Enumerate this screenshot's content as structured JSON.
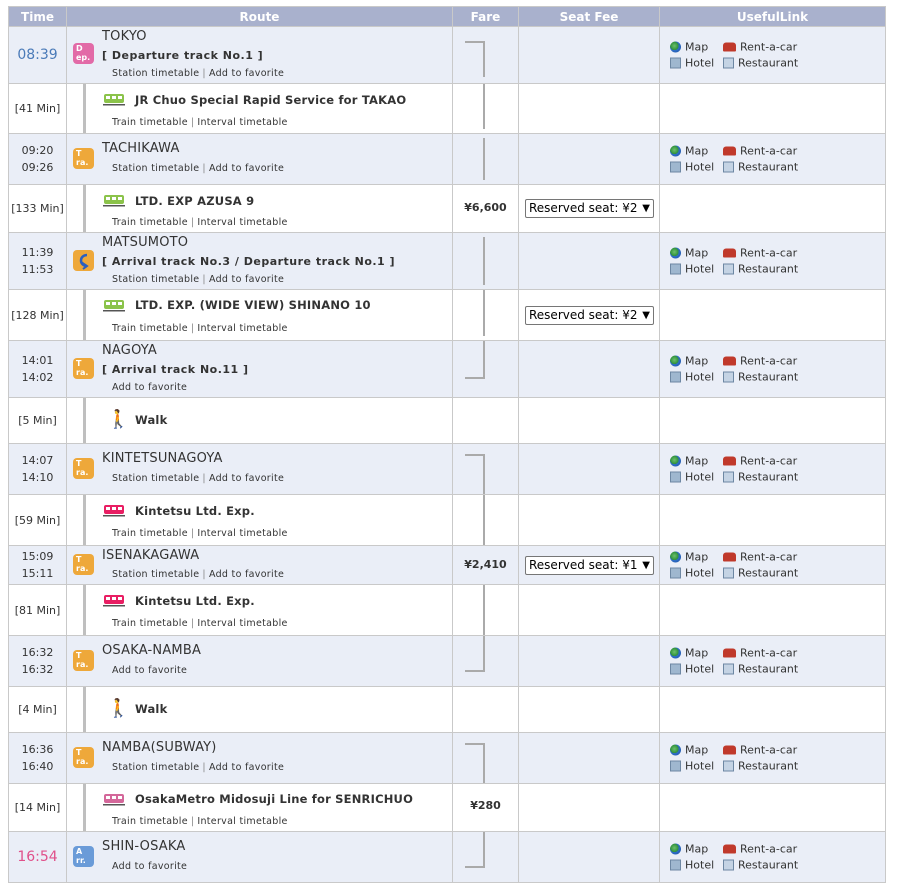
{
  "headers": {
    "time": "Time",
    "route": "Route",
    "fare": "Fare",
    "seat": "Seat Fee",
    "link": "UsefulLink"
  },
  "links": {
    "map": "Map",
    "rent": "Rent-a-car",
    "hotel": "Hotel",
    "restaurant": "Restaurant",
    "station_tt": "Station timetable",
    "fav": "Add to favorite",
    "train_tt": "Train timetable",
    "interval_tt": "Interval timetable",
    "sep": "|"
  },
  "badges": {
    "dep": "D\nep.",
    "tra": "T\nra.",
    "arr": "A\nrr."
  },
  "stations": {
    "tokyo": {
      "time": "08:39",
      "name": "TOKYO",
      "track": "[ Departure track No.1 ]"
    },
    "tachikawa": {
      "arr": "09:20",
      "dep": "09:26",
      "name": "TACHIKAWA"
    },
    "matsumoto": {
      "arr": "11:39",
      "dep": "11:53",
      "name": "MATSUMOTO",
      "track": "[ Arrival track No.3 / Departure track No.1 ]"
    },
    "nagoya": {
      "arr": "14:01",
      "dep": "14:02",
      "name": "NAGOYA",
      "track": "[ Arrival track No.11 ]"
    },
    "kintetsunagoya": {
      "arr": "14:07",
      "dep": "14:10",
      "name": "KINTETSUNAGOYA"
    },
    "isenakagawa": {
      "arr": "15:09",
      "dep": "15:11",
      "name": "ISENAKAGAWA"
    },
    "osakanamba": {
      "arr": "16:32",
      "dep": "16:32",
      "name": "OSAKA-NAMBA"
    },
    "nambasubway": {
      "arr": "16:36",
      "dep": "16:40",
      "name": "NAMBA(SUBWAY)"
    },
    "shinosaka": {
      "time": "16:54",
      "name": "SHIN-OSAKA"
    }
  },
  "segments": {
    "s1": {
      "dur": "[41 Min]",
      "train": "JR Chuo Special Rapid Service  for TAKAO"
    },
    "s2": {
      "dur": "[133 Min]",
      "train": "LTD. EXP AZUSA 9",
      "fare": "¥6,600",
      "seat": "Reserved seat: ¥2"
    },
    "s3": {
      "dur": "[128 Min]",
      "train": "LTD. EXP. (WIDE VIEW) SHINANO 10",
      "seat": "Reserved seat: ¥2"
    },
    "s4": {
      "dur": "[5 Min]",
      "train": "Walk"
    },
    "s5": {
      "dur": "[59 Min]",
      "train": "Kintetsu Ltd. Exp."
    },
    "isefare": {
      "fare": "¥2,410",
      "seat": "Reserved seat: ¥1"
    },
    "s6": {
      "dur": "[81 Min]",
      "train": "Kintetsu Ltd. Exp."
    },
    "s7": {
      "dur": "[4 Min]",
      "train": "Walk"
    },
    "s8": {
      "dur": "[14 Min]",
      "train": "OsakaMetro Midosuji Line  for SENRICHUO",
      "fare": "¥280"
    }
  },
  "colors": {
    "header": "#a9b1cd",
    "station_row": "#eaeef7",
    "dep_time": "#4a7ab8",
    "arr_time": "#e0508a",
    "jr_train": "#7cb342",
    "kintetsu_train": "#d81b60",
    "metro_train": "#c2185b"
  }
}
